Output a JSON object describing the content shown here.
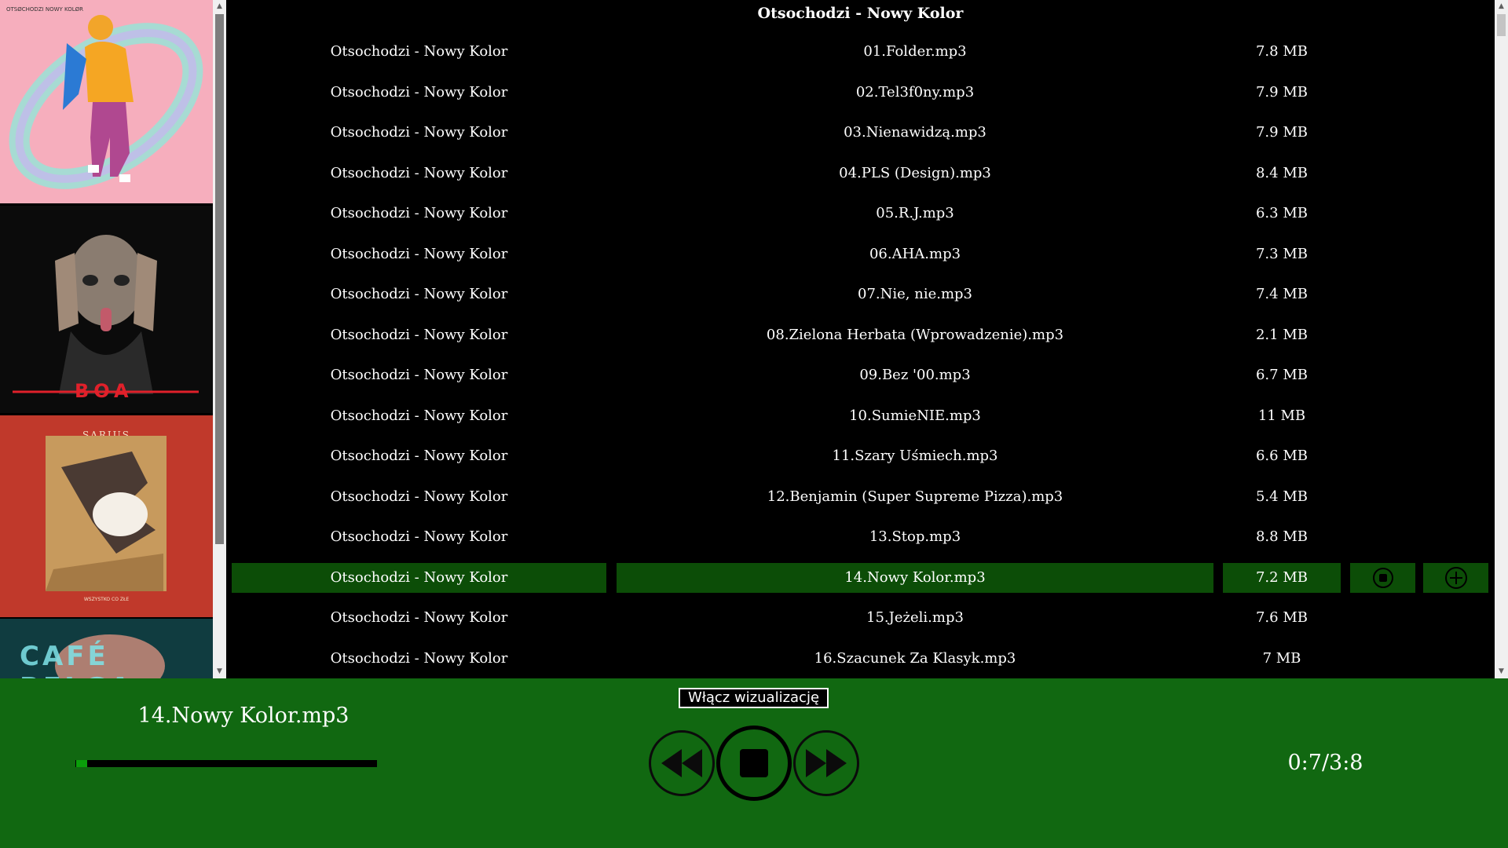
{
  "list": {
    "header_title": "Otsochodzi - Nowy Kolor",
    "active_index": 13,
    "rows": [
      {
        "album": "Otsochodzi - Nowy Kolor",
        "file": "01.Folder.mp3",
        "size": "7.8 MB"
      },
      {
        "album": "Otsochodzi - Nowy Kolor",
        "file": "02.Tel3f0ny.mp3",
        "size": "7.9 MB"
      },
      {
        "album": "Otsochodzi - Nowy Kolor",
        "file": "03.Nienawidzą.mp3",
        "size": "7.9 MB"
      },
      {
        "album": "Otsochodzi - Nowy Kolor",
        "file": "04.PLS (Design).mp3",
        "size": "8.4 MB"
      },
      {
        "album": "Otsochodzi - Nowy Kolor",
        "file": "05.R.J.mp3",
        "size": "6.3 MB"
      },
      {
        "album": "Otsochodzi - Nowy Kolor",
        "file": "06.AHA.mp3",
        "size": "7.3 MB"
      },
      {
        "album": "Otsochodzi - Nowy Kolor",
        "file": "07.Nie, nie.mp3",
        "size": "7.4 MB"
      },
      {
        "album": "Otsochodzi - Nowy Kolor",
        "file": "08.Zielona Herbata (Wprowadzenie).mp3",
        "size": "2.1 MB"
      },
      {
        "album": "Otsochodzi - Nowy Kolor",
        "file": "09.Bez '00.mp3",
        "size": "6.7 MB"
      },
      {
        "album": "Otsochodzi - Nowy Kolor",
        "file": "10.SumieNIE.mp3",
        "size": "11 MB"
      },
      {
        "album": "Otsochodzi - Nowy Kolor",
        "file": "11.Szary Uśmiech.mp3",
        "size": "6.6 MB"
      },
      {
        "album": "Otsochodzi - Nowy Kolor",
        "file": "12.Benjamin (Super Supreme Pizza).mp3",
        "size": "5.4 MB"
      },
      {
        "album": "Otsochodzi - Nowy Kolor",
        "file": "13.Stop.mp3",
        "size": "8.8 MB"
      },
      {
        "album": "Otsochodzi - Nowy Kolor",
        "file": "14.Nowy Kolor.mp3",
        "size": "7.2 MB"
      },
      {
        "album": "Otsochodzi - Nowy Kolor",
        "file": "15.Jeżeli.mp3",
        "size": "7.6 MB"
      },
      {
        "album": "Otsochodzi - Nowy Kolor",
        "file": "16.Szacunek Za Klasyk.mp3",
        "size": "7 MB"
      }
    ],
    "row_buttons": {
      "stop_icon": "stop-circle-icon",
      "add_icon": "plus-circle-icon"
    }
  },
  "sidebar": {
    "covers": [
      {
        "name": "album-cover-nowy-kolor",
        "logo_text": "OTSØCHODZI NOWY KOLØR"
      },
      {
        "name": "album-cover-boa",
        "logo_text": "BOA"
      },
      {
        "name": "album-cover-sarius",
        "logo_text": "SARIUS",
        "sub_text": "WSZYSTKO CO ZŁE"
      },
      {
        "name": "album-cover-cafe-belga",
        "logo_text": "CAFÉ BELGA"
      }
    ]
  },
  "player": {
    "visualization_button": "Włącz wizualizację",
    "now_playing": "14.Nowy Kolor.mp3",
    "time": "0:7/3:8",
    "progress_fraction": 0.04,
    "controls": [
      "rewind-icon",
      "stop-icon",
      "fast-forward-icon"
    ]
  },
  "colors": {
    "player_bg": "#116811",
    "active_row": "#0c4d07",
    "progress_knob": "#0a9e0a",
    "boa_red": "#e0202a",
    "sarius_red": "#c0392b",
    "cover1_pink": "#f4a7b9"
  }
}
